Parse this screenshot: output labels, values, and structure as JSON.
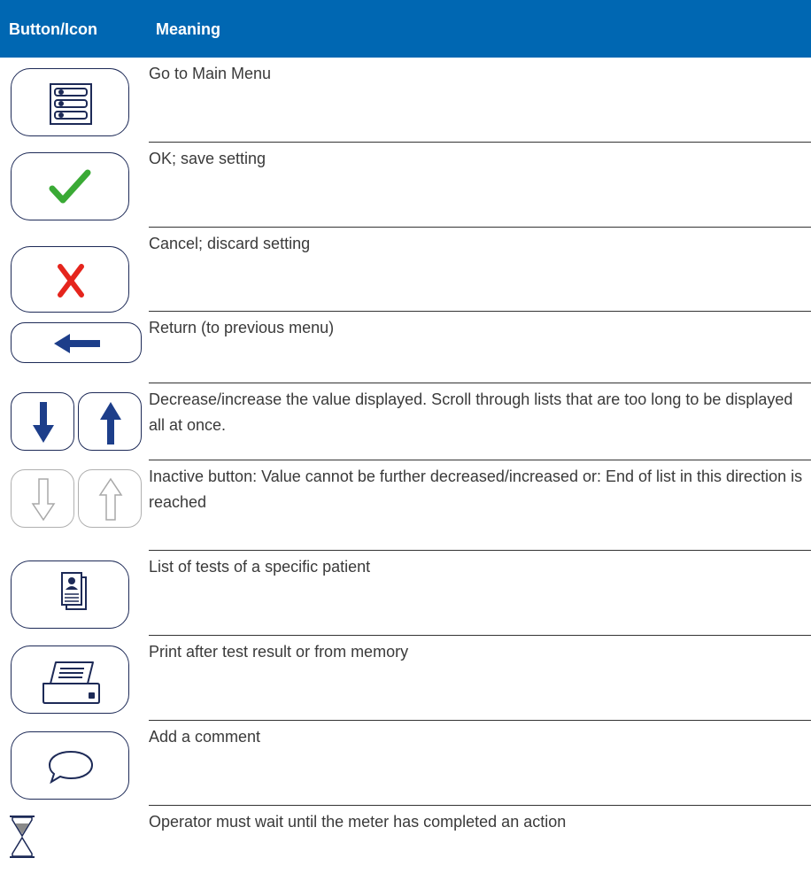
{
  "table": {
    "col_button": "Button/Icon",
    "col_meaning": "Meaning"
  },
  "rows": [
    {
      "icon": "main-menu-icon",
      "meaning": "Go to Main Menu"
    },
    {
      "icon": "checkmark-icon",
      "meaning": "OK; save setting",
      "color": "#3aaa35"
    },
    {
      "icon": "x-cross-icon",
      "meaning": "Cancel; discard setting",
      "color": "#e5251d"
    },
    {
      "icon": "arrow-left-icon",
      "meaning": "Return (to previous menu)",
      "color": "#1d3e8a"
    },
    {
      "icon": "arrow-down-up-icons",
      "meaning": "Decrease/increase the value displayed. Scroll through lists that are too long to be displayed all at once.",
      "color": "#1d3e8a"
    },
    {
      "icon": "inactive-arrow-down-up-icons",
      "meaning": "Inactive button: Value cannot be further decreased/increased or: End of list in this direction is reached",
      "color": "#b0b0b0"
    },
    {
      "icon": "patient-list-icon",
      "meaning": "List of tests of a specific patient"
    },
    {
      "icon": "printer-icon",
      "meaning": "Print after test result or from memory"
    },
    {
      "icon": "comment-bubble-icon",
      "meaning": "Add a comment"
    },
    {
      "icon": "hourglass-icon",
      "meaning": "Operator must wait until the meter has completed an action"
    }
  ]
}
